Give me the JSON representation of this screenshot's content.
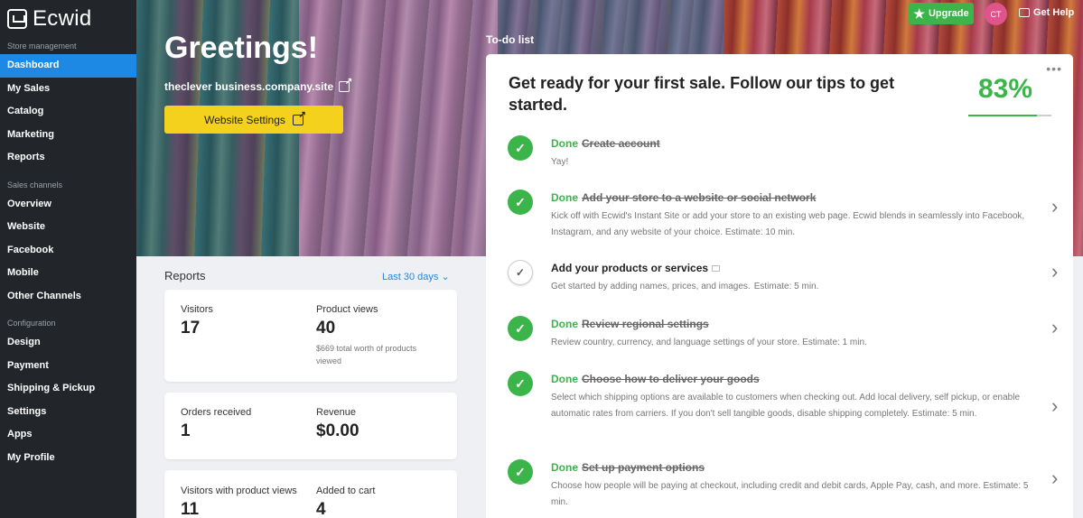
{
  "sidebar": {
    "logo": "Ecwid",
    "sections": [
      {
        "title": "Store management",
        "items": [
          "Dashboard",
          "My Sales",
          "Catalog",
          "Marketing",
          "Reports"
        ]
      },
      {
        "title": "Sales channels",
        "items": [
          "Overview",
          "Website",
          "Facebook",
          "Mobile",
          "Other Channels"
        ]
      },
      {
        "title": "Configuration",
        "items": [
          "Design",
          "Payment",
          "Shipping & Pickup",
          "Settings",
          "Apps",
          "My Profile"
        ]
      }
    ],
    "active": "Dashboard"
  },
  "hero": {
    "greeting": "Greetings!",
    "site_url": "theclever business.company.site",
    "site_button": "Website Settings"
  },
  "topbar": {
    "upgrade": "Upgrade",
    "avatar": "CT",
    "help": "Get Help"
  },
  "reports": {
    "title": "Reports",
    "range": "Last 30 days",
    "cards": [
      {
        "left": {
          "label": "Visitors",
          "value": "17"
        },
        "right": {
          "label": "Product views",
          "value": "40",
          "note": "$669 total worth of products viewed"
        }
      },
      {
        "left": {
          "label": "Orders received",
          "value": "1"
        },
        "right": {
          "label": "Revenue",
          "value": "$0.00"
        }
      },
      {
        "left": {
          "label": "Visitors with product views",
          "value": "11"
        },
        "right": {
          "label": "Added to cart",
          "value": "4"
        }
      }
    ]
  },
  "todo": {
    "header": "To-do list",
    "title": "Get ready for your first sale. Follow our tips to get started.",
    "percent": "83%",
    "progress": 0.83,
    "done_label": "Done",
    "tasks": [
      {
        "done": true,
        "title": "Create account",
        "desc": "Yay!",
        "chevron": false
      },
      {
        "done": true,
        "title": "Add your store to a website or social network",
        "desc": "Kick off with Ecwid's Instant Site or add your store to an existing web page. Ecwid blends in seamlessly into Facebook, Instagram, and any website of your choice. Estimate: 10 min.",
        "chevron": true
      },
      {
        "done": false,
        "title": "Add your products or services",
        "desc": "Get started by adding names, prices, and images.",
        "estimate": "Estimate: 5 min.",
        "chevron": true
      },
      {
        "done": true,
        "title": "Review regional settings",
        "desc": "Review country, currency, and language settings of your store. Estimate: 1 min.",
        "chevron": true
      },
      {
        "done": true,
        "title": "Choose how to deliver your goods",
        "desc": "Select which shipping options are available to customers when checking out. Add local delivery, self pickup, or enable automatic rates from carriers. If you don't sell tangible goods, disable shipping completely. Estimate: 5 min.",
        "chevron": true
      },
      {
        "done": true,
        "title": "Set up payment options",
        "desc": "Choose how people will be paying at checkout, including credit and debit cards, Apple Pay, cash, and more. Estimate: 5 min.",
        "chevron": true
      }
    ]
  },
  "colors": {
    "accent": "#1e88e5",
    "success": "#3bb54a",
    "button_yellow": "#f4d11d",
    "sidebar": "#22262b"
  }
}
